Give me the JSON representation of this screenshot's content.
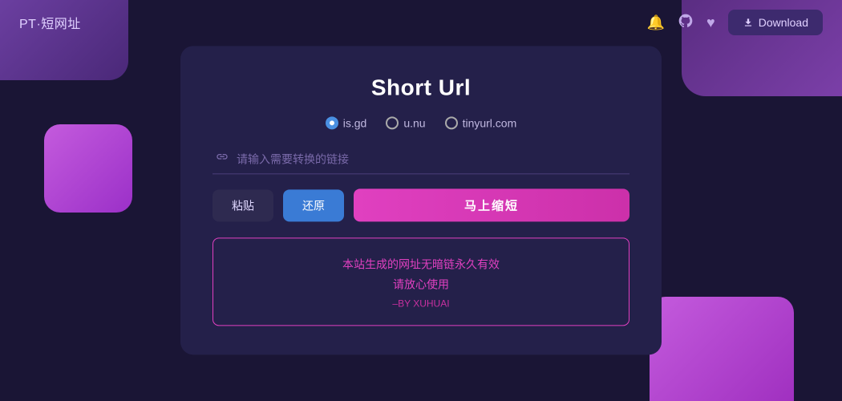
{
  "header": {
    "logo": "PT·短网址",
    "icons": {
      "bell": "🔔",
      "github": "⌥",
      "heart": "♥"
    },
    "download_label": "Download"
  },
  "card": {
    "title": "Short Url",
    "radio_options": [
      {
        "id": "isgd",
        "label": "is.gd",
        "selected": true
      },
      {
        "id": "unu",
        "label": "u.nu",
        "selected": false
      },
      {
        "id": "tinyurl",
        "label": "tinyurl.com",
        "selected": false
      }
    ],
    "input_placeholder": "请输入需要转换的链接",
    "btn_paste": "粘贴",
    "btn_restore": "还原",
    "btn_shorten": "马上缩短",
    "info": {
      "line1": "本站生成的网址无暗链永久有效",
      "line2": "请放心使用",
      "line3": "–BY XUHUAI"
    }
  }
}
